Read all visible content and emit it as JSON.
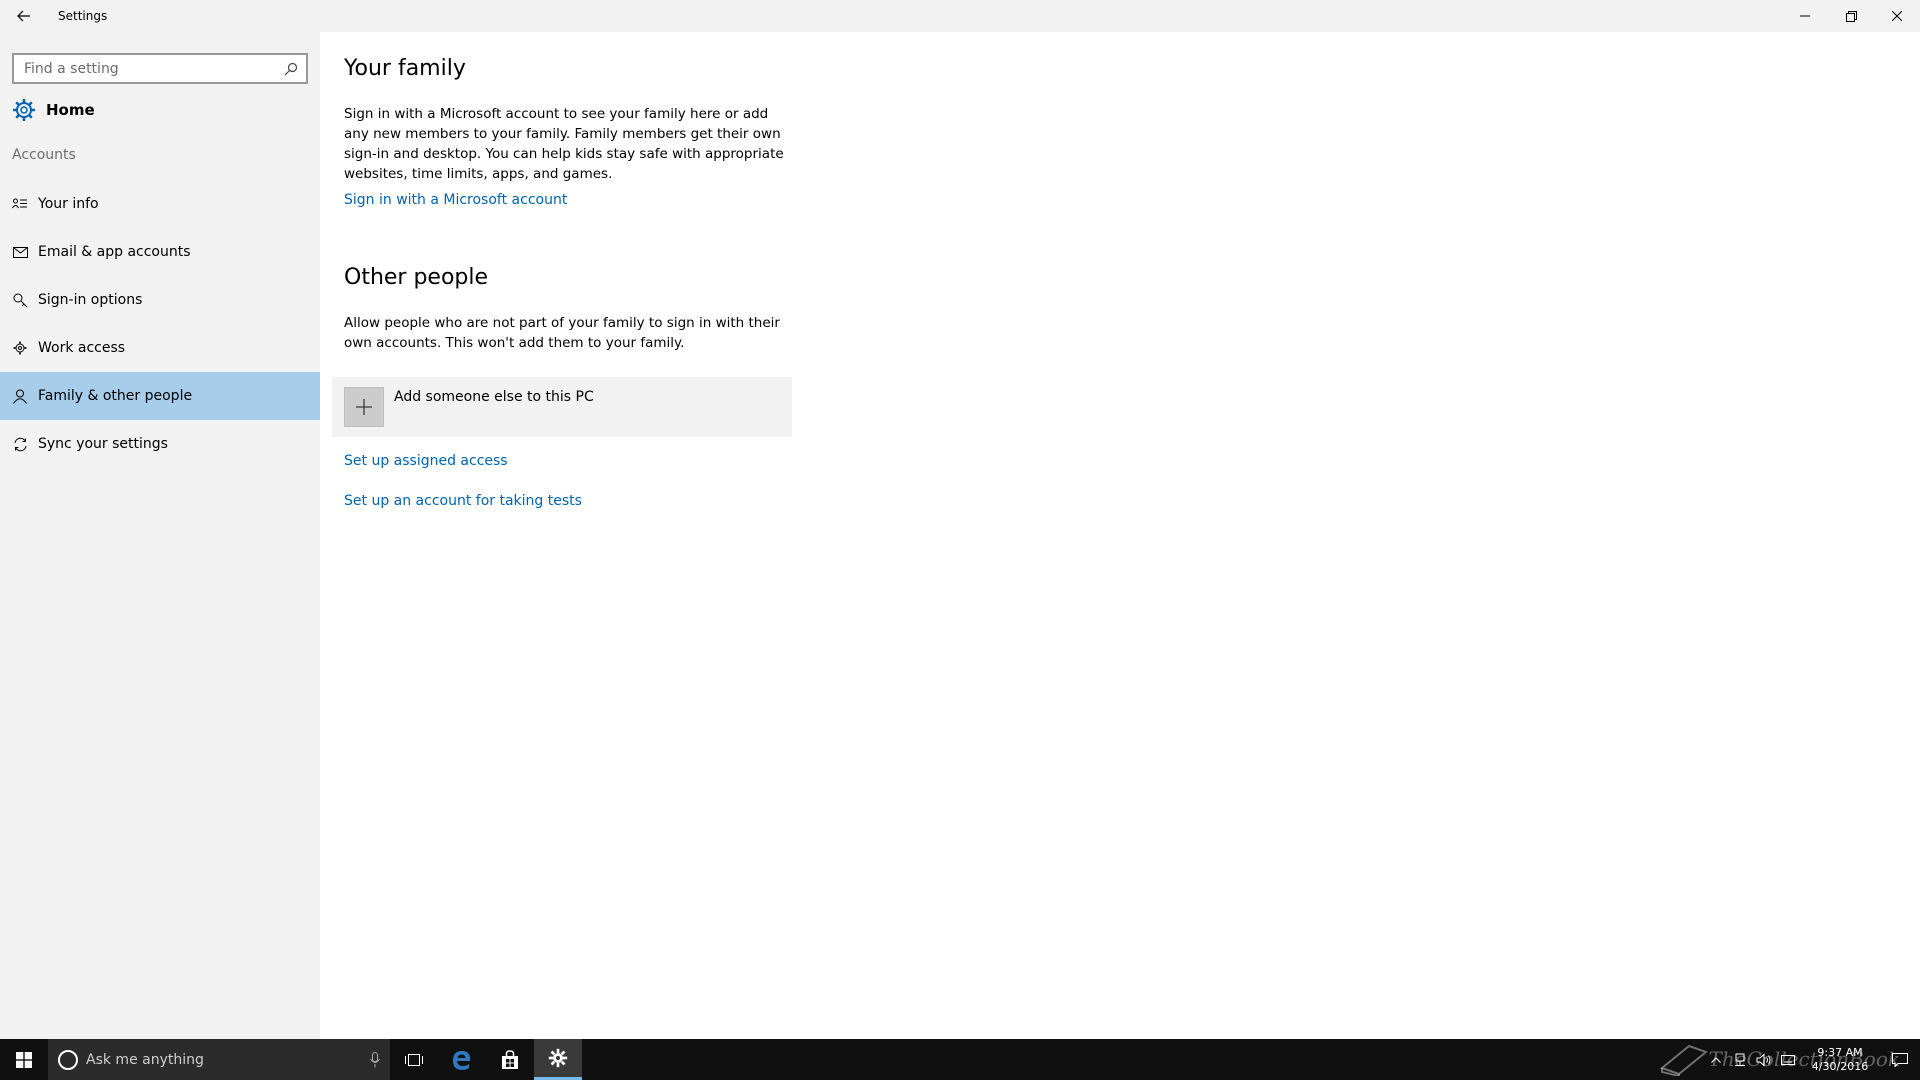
{
  "window": {
    "title": "Settings",
    "back_icon": "back-arrow-icon",
    "controls": [
      "minimize-icon",
      "restore-icon",
      "close-icon"
    ]
  },
  "sidebar": {
    "search_placeholder": "Find a setting",
    "home_label": "Home",
    "section_label": "Accounts",
    "items": [
      {
        "label": "Your info",
        "icon": "contact-card-icon",
        "active": false
      },
      {
        "label": "Email & app accounts",
        "icon": "mail-icon",
        "active": false
      },
      {
        "label": "Sign-in options",
        "icon": "key-icon",
        "active": false
      },
      {
        "label": "Work access",
        "icon": "briefcase-gear-icon",
        "active": false
      },
      {
        "label": "Family & other people",
        "icon": "person-icon",
        "active": true
      },
      {
        "label": "Sync your settings",
        "icon": "sync-icon",
        "active": false
      }
    ]
  },
  "main": {
    "family_heading": "Your family",
    "family_text": "Sign in with a Microsoft account to see your family here or add any new members to your family. Family members get their own sign-in and desktop. You can help kids stay safe with appropriate websites, time limits, apps, and games.",
    "family_link": "Sign in with a Microsoft account",
    "other_heading": "Other people",
    "other_text": "Allow people who are not part of your family to sign in with their own accounts. This won't add them to your family.",
    "add_label": "Add someone else to this PC",
    "assigned_link": "Set up assigned access",
    "tests_link": "Set up an account for taking tests"
  },
  "taskbar": {
    "cortana_placeholder": "Ask me anything",
    "time": "9:37 AM",
    "date": "4/30/2016",
    "watermark": "TheCollectionBook"
  },
  "colors": {
    "accent": "#0063b1",
    "active_nav": "#a7cdeb",
    "sidebar_bg": "#f2f2f2",
    "taskbar_bg": "#101010"
  }
}
